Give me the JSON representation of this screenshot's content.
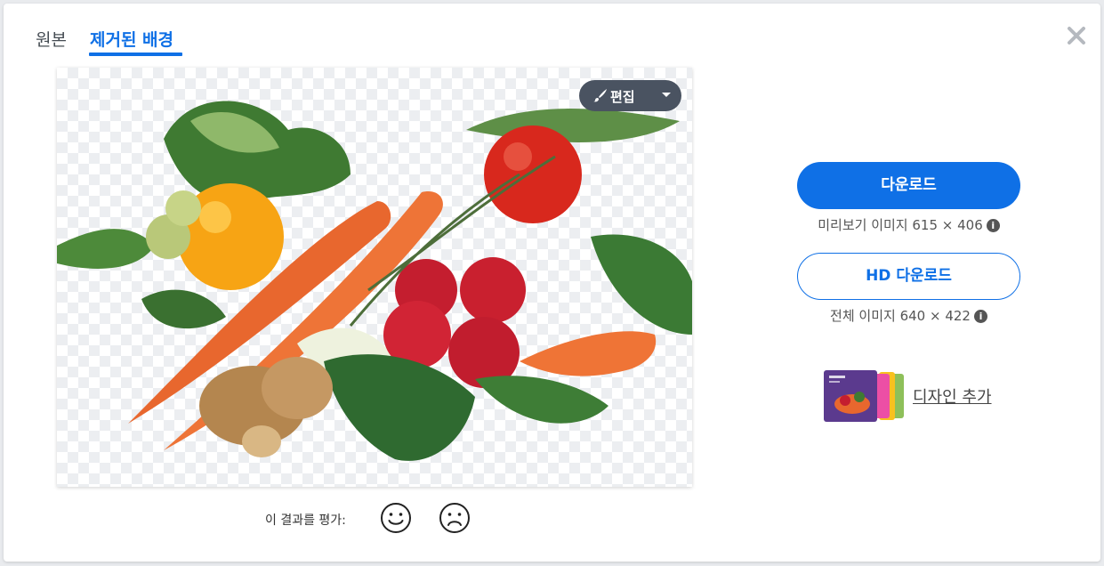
{
  "tabs": {
    "original": "원본",
    "removed_background": "제거된 배경"
  },
  "editor": {
    "edit_label": "편집"
  },
  "rating": {
    "label": "이 결과를 평가:"
  },
  "download": {
    "button_label": "다운로드",
    "preview_info": "미리보기 이미지 615 × 406",
    "hd_button_label": "HD 다운로드",
    "full_info": "전체 이미지 640 × 422"
  },
  "design": {
    "add_label": "디자인 추가"
  },
  "icons": {
    "close": "close-icon",
    "brush": "brush-icon",
    "caret": "chevron-down-icon",
    "info": "info-icon",
    "happy": "smile-face-icon",
    "sad": "frown-face-icon"
  },
  "colors": {
    "accent": "#0f70e6",
    "edit_button": "#4a5361",
    "text": "#454c53"
  }
}
